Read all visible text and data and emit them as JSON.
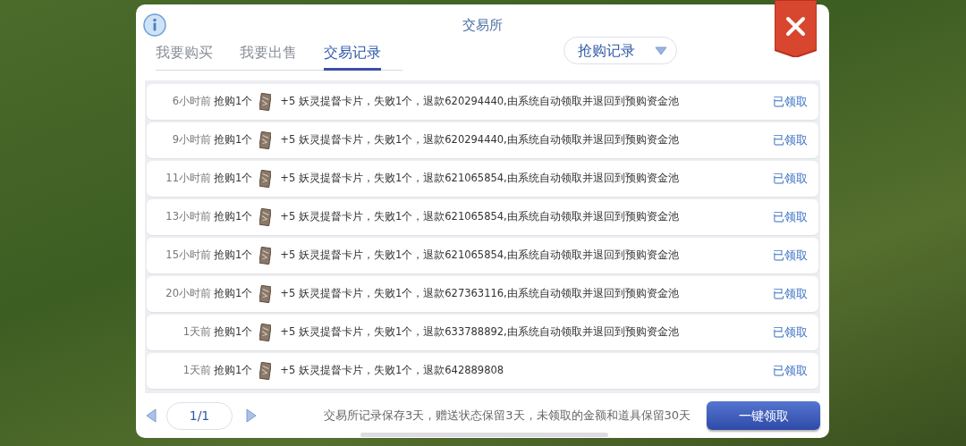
{
  "dialog": {
    "title": "交易所",
    "tabs": [
      {
        "label": "我要购买",
        "selected": false
      },
      {
        "label": "我要出售",
        "selected": false
      },
      {
        "label": "交易记录",
        "selected": true
      }
    ],
    "filter": {
      "label": "抢购记录"
    },
    "records": [
      {
        "time": "6小时前",
        "action": "抢购1个",
        "description": "+5 妖灵提督卡片，失败1个，退款620294440,由系统自动领取并退回到预购资金池",
        "status": "已领取"
      },
      {
        "time": "9小时前",
        "action": "抢购1个",
        "description": "+5 妖灵提督卡片，失败1个，退款620294440,由系统自动领取并退回到预购资金池",
        "status": "已领取"
      },
      {
        "time": "11小时前",
        "action": "抢购1个",
        "description": "+5 妖灵提督卡片，失败1个，退款621065854,由系统自动领取并退回到预购资金池",
        "status": "已领取"
      },
      {
        "time": "13小时前",
        "action": "抢购1个",
        "description": "+5 妖灵提督卡片，失败1个，退款621065854,由系统自动领取并退回到预购资金池",
        "status": "已领取"
      },
      {
        "time": "15小时前",
        "action": "抢购1个",
        "description": "+5 妖灵提督卡片，失败1个，退款621065854,由系统自动领取并退回到预购资金池",
        "status": "已领取"
      },
      {
        "time": "20小时前",
        "action": "抢购1个",
        "description": "+5 妖灵提督卡片，失败1个，退款627363116,由系统自动领取并退回到预购资金池",
        "status": "已领取"
      },
      {
        "time": "1天前",
        "action": "抢购1个",
        "description": "+5 妖灵提督卡片，失败1个，退款633788892,由系统自动领取并退回到预购资金池",
        "status": "已领取"
      },
      {
        "time": "1天前",
        "action": "抢购1个",
        "description": "+5 妖灵提督卡片，失败1个，退款642889808",
        "status": "已领取"
      }
    ],
    "pagination": {
      "page": "1/1"
    },
    "note": "交易所记录保存3天，赠送状态保留3天，未领取的金额和道具保留30天",
    "claim_all_button": "一键领取"
  }
}
